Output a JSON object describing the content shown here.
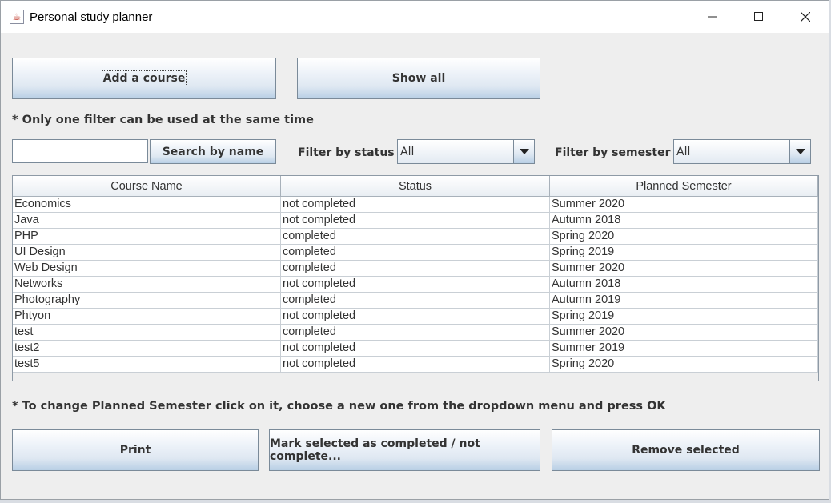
{
  "window": {
    "title": "Personal study planner",
    "controls": [
      "minimize",
      "maximize",
      "close"
    ]
  },
  "toolbar": {
    "add_course": "Add a course",
    "show_all": "Show all"
  },
  "notes": {
    "filter_note": "* Only one filter can be used at the same time",
    "semester_note": "* To change Planned Semester click on it, choose a new one from the dropdown menu and press OK"
  },
  "filters": {
    "search_value": "",
    "search_button": "Search by name",
    "status_label": "Filter by status",
    "status_selected": "All",
    "semester_label": "Filter by semester",
    "semester_selected": "All"
  },
  "table": {
    "columns": [
      "Course Name",
      "Status",
      "Planned Semester"
    ],
    "rows": [
      [
        "Economics",
        "not completed",
        "Summer 2020"
      ],
      [
        "Java",
        "not completed",
        "Autumn 2018"
      ],
      [
        "PHP",
        "completed",
        "Spring 2020"
      ],
      [
        "UI Design",
        "completed",
        "Spring 2019"
      ],
      [
        "Web Design",
        "completed",
        "Summer 2020"
      ],
      [
        "Networks",
        "not completed",
        "Autumn 2018"
      ],
      [
        "Photography",
        "completed",
        "Autumn 2019"
      ],
      [
        "Phtyon",
        "not completed",
        "Spring 2019"
      ],
      [
        "test",
        "completed",
        "Summer 2020"
      ],
      [
        "test2",
        "not completed",
        "Summer 2019"
      ],
      [
        "test5",
        "not completed",
        "Spring 2020"
      ]
    ]
  },
  "actions": {
    "print": "Print",
    "mark": "Mark selected as completed / not complete...",
    "remove": "Remove selected"
  }
}
